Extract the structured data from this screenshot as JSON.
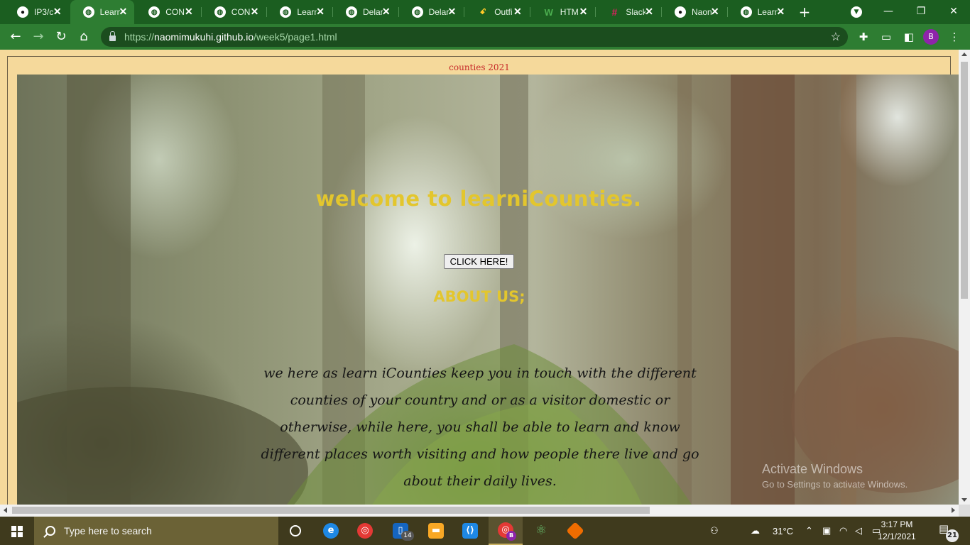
{
  "browser": {
    "tabs": [
      {
        "label": "IP3/c",
        "favicon": "github-icon",
        "active": false
      },
      {
        "label": "Learn",
        "favicon": "globe-icon",
        "active": true
      },
      {
        "label": "CON",
        "favicon": "globe-icon",
        "active": false
      },
      {
        "label": "CON",
        "favicon": "globe-icon",
        "active": false
      },
      {
        "label": "Learn",
        "favicon": "globe-icon",
        "active": false
      },
      {
        "label": "Delar",
        "favicon": "globe-icon",
        "active": false
      },
      {
        "label": "Delar",
        "favicon": "globe-icon",
        "active": false
      },
      {
        "label": "Outfi",
        "favicon": "outfit-icon",
        "active": false
      },
      {
        "label": "HTM",
        "favicon": "w3schools-icon",
        "active": false
      },
      {
        "label": "Slack",
        "favicon": "slack-icon",
        "active": false
      },
      {
        "label": "Naon",
        "favicon": "github-icon",
        "active": false
      },
      {
        "label": "Learn",
        "favicon": "globe-icon",
        "active": false
      }
    ],
    "url": {
      "scheme": "https://",
      "host": "naomimukuhi.github.io",
      "path": "/week5/page1.html"
    },
    "profile_initial": "B",
    "theme_color": "#2e7d32"
  },
  "page": {
    "caption": "counties 2021",
    "hero_title": "welcome to learniCounties.",
    "cta_label": "CLICK HERE!",
    "about_heading": "ABOUT US;",
    "about_lines": [
      "we here as learn iCounties keep you in touch with the different",
      "counties of your country and or as a visitor domestic or",
      "otherwise, while here, you shall be able to learn and know",
      "different places worth visiting and how people there live and go",
      "about their daily lives."
    ],
    "accent_color": "#e3c62d",
    "caption_color": "#c62828",
    "background_color": "#f5d99b"
  },
  "watermark": {
    "line1": "Activate Windows",
    "line2": "Go to Settings to activate Windows."
  },
  "taskbar": {
    "search_placeholder": "Type here to search",
    "explorer_badge": "14",
    "chrome_badge": "B",
    "weather": "31°C",
    "time": "3:17 PM",
    "date": "12/1/2021",
    "notification_count": "21"
  }
}
